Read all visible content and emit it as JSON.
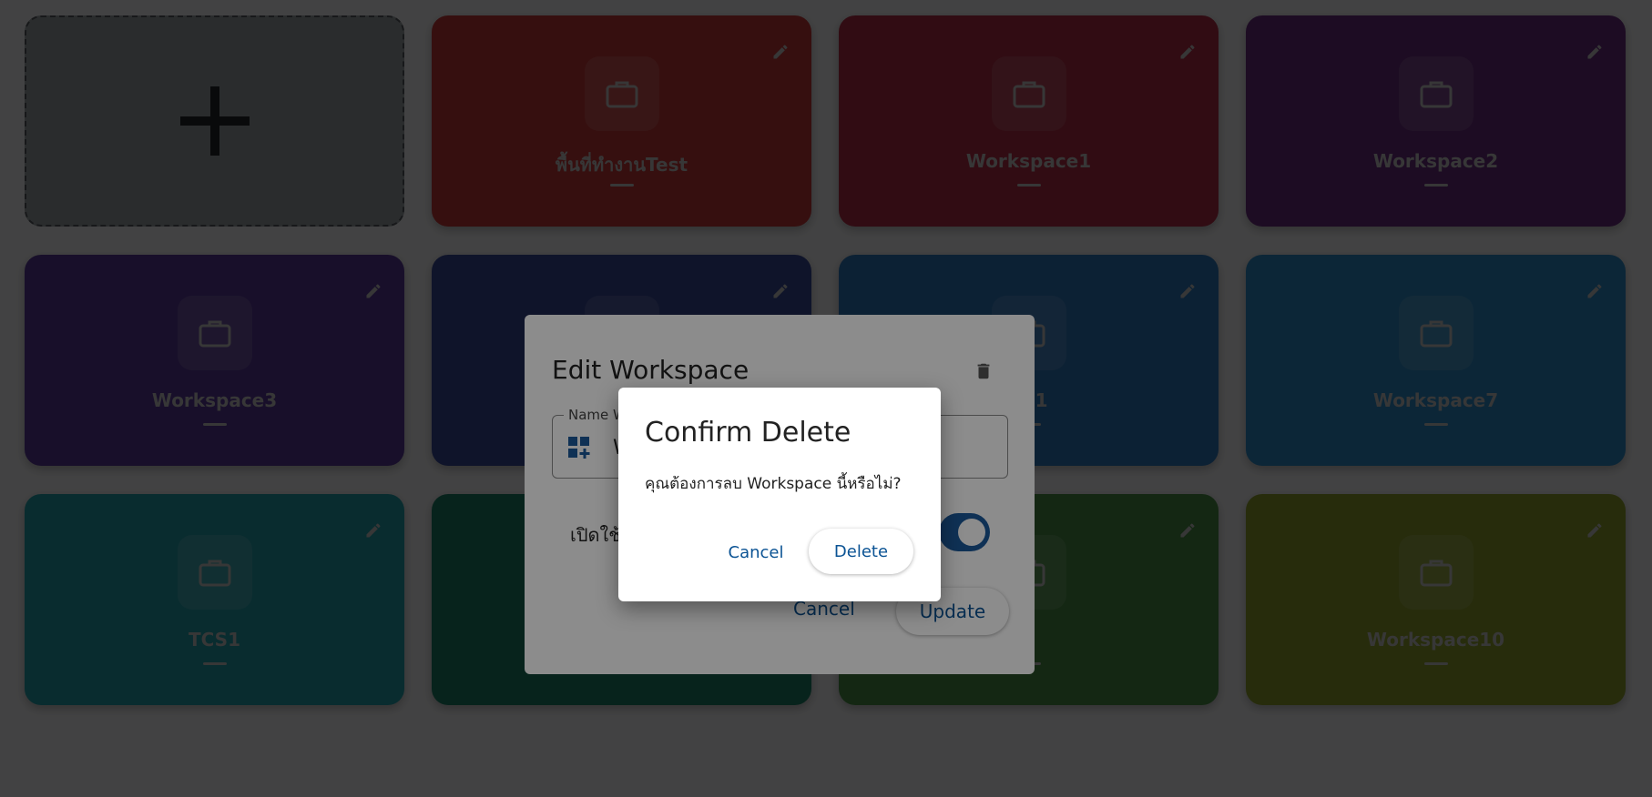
{
  "add_card": {
    "icon": "plus-icon"
  },
  "workspaces": [
    {
      "name": "พื้นที่ทำงานTest",
      "color": "#c73a3a"
    },
    {
      "name": "Workspace1",
      "color": "#b32e46"
    },
    {
      "name": "Workspace2",
      "color": "#6b2f80"
    },
    {
      "name": "Workspace3",
      "color": "#5a3a9a"
    },
    {
      "name": "",
      "color": "#3a4a9b"
    },
    {
      "name": "TS1",
      "color": "#2f78c0"
    },
    {
      "name": "Workspace7",
      "color": "#2c8cc8"
    },
    {
      "name": "TCS1",
      "color": "#22a2ad"
    },
    {
      "name": "",
      "color": "#1c8068"
    },
    {
      "name": "",
      "color": "#4a9148"
    },
    {
      "name": "Workspace10",
      "color": "#8fa32f"
    }
  ],
  "edit_dialog": {
    "title": "Edit Workspace",
    "field_label": "Name W",
    "field_value": "W",
    "toggle_label": "เปิดใช้",
    "toggle_on": true,
    "cancel_label": "Cancel",
    "update_label": "Update"
  },
  "confirm_dialog": {
    "title": "Confirm Delete",
    "message": "คุณต้องการลบ Workspace นี้หรือไม่?",
    "cancel_label": "Cancel",
    "delete_label": "Delete"
  }
}
